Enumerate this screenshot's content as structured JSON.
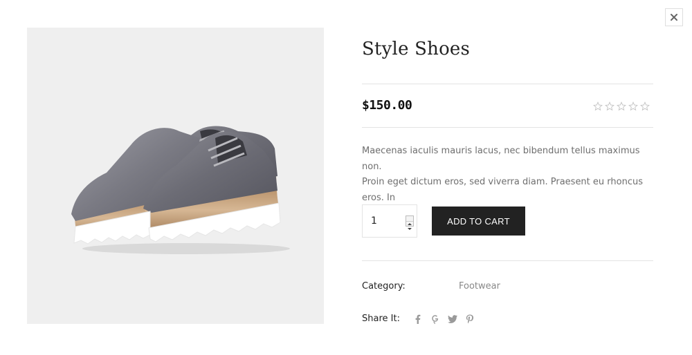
{
  "modal": {
    "close_label": "×"
  },
  "product": {
    "image_alt": "Metallic silver platform oxford shoes with wooden sole",
    "title": "Style Shoes",
    "price": "$150.00",
    "rating": {
      "filled": 0,
      "max": 5
    },
    "description": "Maecenas iaculis mauris lacus, nec bibendum tellus maximus non.\nProin eget dictum eros, sed viverra diam. Praesent eu rhoncus eros. In",
    "quantity": "1",
    "add_to_cart_label": "ADD TO CART",
    "category_label": "Category:",
    "category_value": "Footwear",
    "share_label": "Share It:",
    "share_icons": [
      "facebook-icon",
      "google-plus-icon",
      "twitter-icon",
      "pinterest-icon"
    ]
  },
  "colors": {
    "button_bg": "#222222",
    "text_muted": "#6e6e6e",
    "divider": "#e3e3e3",
    "image_bg": "#efefef"
  }
}
